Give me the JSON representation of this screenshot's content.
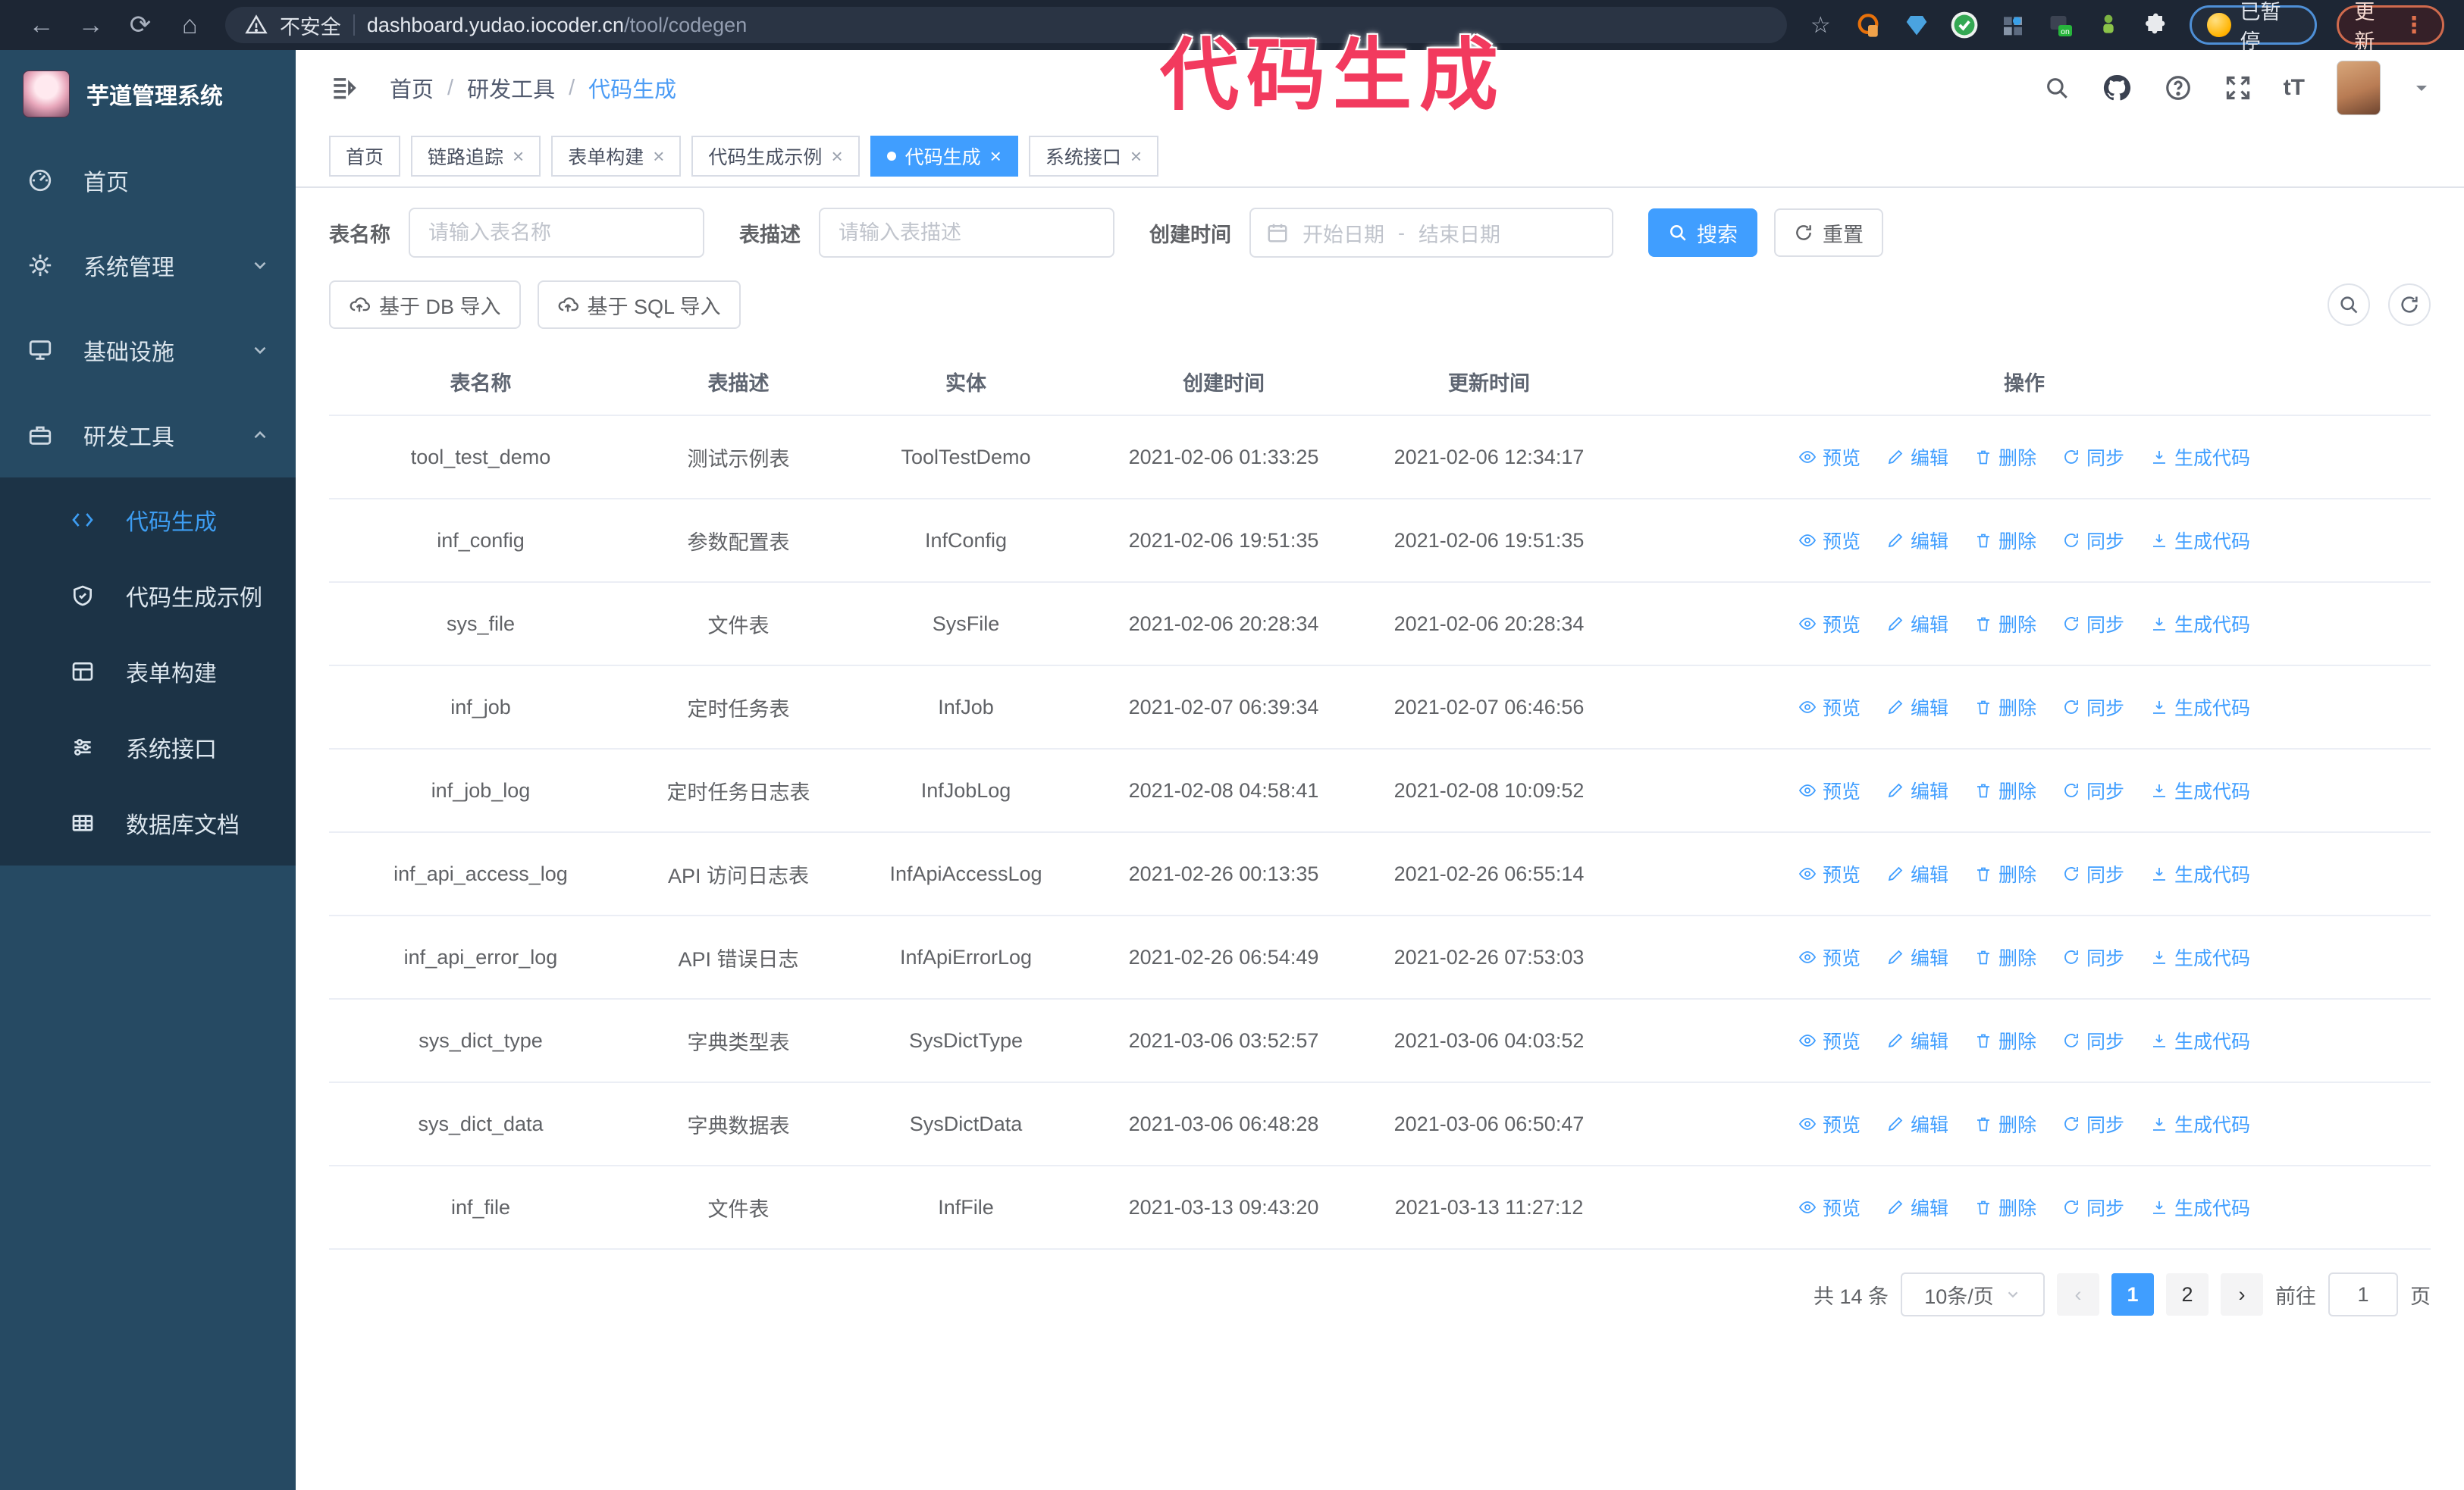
{
  "browser": {
    "security_label": "不安全",
    "url_host": "dashboard.yudao.iocoder.cn",
    "url_path": "/tool/codegen",
    "paused_label": "已暂停",
    "update_label": "更新"
  },
  "annotation": {
    "text": "代码生成",
    "color": "#f23a5e"
  },
  "sidebar": {
    "title": "芋道管理系统",
    "items": [
      {
        "label": "首页",
        "icon": "dashboard-icon",
        "chevron": ""
      },
      {
        "label": "系统管理",
        "icon": "gear-icon",
        "chevron": "down"
      },
      {
        "label": "基础设施",
        "icon": "monitor-icon",
        "chevron": "down"
      },
      {
        "label": "研发工具",
        "icon": "briefcase-icon",
        "chevron": "up"
      }
    ],
    "submenu": [
      {
        "label": "代码生成",
        "icon": "code-icon",
        "active": true
      },
      {
        "label": "代码生成示例",
        "icon": "shield-check-icon",
        "active": false
      },
      {
        "label": "表单构建",
        "icon": "form-icon",
        "active": false
      },
      {
        "label": "系统接口",
        "icon": "sliders-icon",
        "active": false
      },
      {
        "label": "数据库文档",
        "icon": "database-icon",
        "active": false
      }
    ]
  },
  "header": {
    "breadcrumb": [
      "首页",
      "研发工具",
      "代码生成"
    ],
    "accent_color": "#409eff"
  },
  "tabs": [
    {
      "label": "首页",
      "active": false,
      "closable": false
    },
    {
      "label": "链路追踪",
      "active": false,
      "closable": true
    },
    {
      "label": "表单构建",
      "active": false,
      "closable": true
    },
    {
      "label": "代码生成示例",
      "active": false,
      "closable": true
    },
    {
      "label": "代码生成",
      "active": true,
      "closable": true
    },
    {
      "label": "系统接口",
      "active": false,
      "closable": true
    }
  ],
  "filters": {
    "name_label": "表名称",
    "name_placeholder": "请输入表名称",
    "desc_label": "表描述",
    "desc_placeholder": "请输入表描述",
    "time_label": "创建时间",
    "start_placeholder": "开始日期",
    "range_separator": "-",
    "end_placeholder": "结束日期",
    "search_label": "搜索",
    "reset_label": "重置"
  },
  "toolbar": {
    "import_db_label": "基于 DB 导入",
    "import_sql_label": "基于 SQL 导入"
  },
  "table": {
    "columns": [
      "表名称",
      "表描述",
      "实体",
      "创建时间",
      "更新时间",
      "操作"
    ],
    "actions": [
      "预览",
      "编辑",
      "删除",
      "同步",
      "生成代码"
    ],
    "rows": [
      {
        "name": "tool_test_demo",
        "desc": "测试示例表",
        "entity": "ToolTestDemo",
        "created": "2021-02-06 01:33:25",
        "updated": "2021-02-06 12:34:17"
      },
      {
        "name": "inf_config",
        "desc": "参数配置表",
        "entity": "InfConfig",
        "created": "2021-02-06 19:51:35",
        "updated": "2021-02-06 19:51:35"
      },
      {
        "name": "sys_file",
        "desc": "文件表",
        "entity": "SysFile",
        "created": "2021-02-06 20:28:34",
        "updated": "2021-02-06 20:28:34"
      },
      {
        "name": "inf_job",
        "desc": "定时任务表",
        "entity": "InfJob",
        "created": "2021-02-07 06:39:34",
        "updated": "2021-02-07 06:46:56"
      },
      {
        "name": "inf_job_log",
        "desc": "定时任务日志表",
        "entity": "InfJobLog",
        "created": "2021-02-08 04:58:41",
        "updated": "2021-02-08 10:09:52"
      },
      {
        "name": "inf_api_access_log",
        "desc": "API 访问日志表",
        "entity": "InfApiAccessLog",
        "created": "2021-02-26 00:13:35",
        "updated": "2021-02-26 06:55:14"
      },
      {
        "name": "inf_api_error_log",
        "desc": "API 错误日志",
        "entity": "InfApiErrorLog",
        "created": "2021-02-26 06:54:49",
        "updated": "2021-02-26 07:53:03"
      },
      {
        "name": "sys_dict_type",
        "desc": "字典类型表",
        "entity": "SysDictType",
        "created": "2021-03-06 03:52:57",
        "updated": "2021-03-06 04:03:52"
      },
      {
        "name": "sys_dict_data",
        "desc": "字典数据表",
        "entity": "SysDictData",
        "created": "2021-03-06 06:48:28",
        "updated": "2021-03-06 06:50:47"
      },
      {
        "name": "inf_file",
        "desc": "文件表",
        "entity": "InfFile",
        "created": "2021-03-13 09:43:20",
        "updated": "2021-03-13 11:27:12"
      }
    ]
  },
  "pagination": {
    "total_label": "共 14 条",
    "page_size": "10条/页",
    "pages": [
      "1",
      "2"
    ],
    "active_page": "1",
    "goto_label": "前往",
    "goto_value": "1",
    "page_suffix": "页"
  }
}
